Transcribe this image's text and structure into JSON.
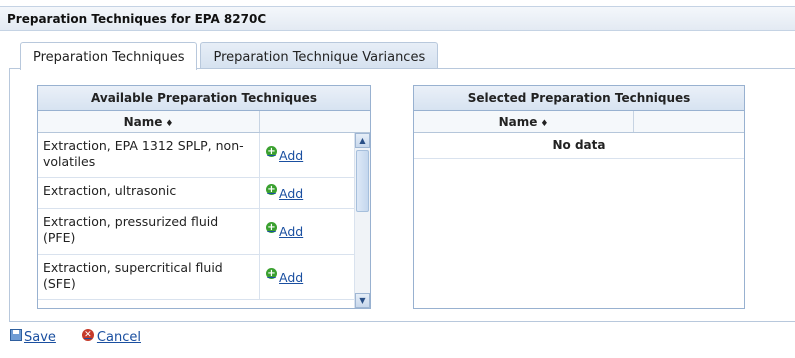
{
  "window": {
    "title": "Preparation Techniques for EPA 8270C"
  },
  "tabs": [
    {
      "label": "Preparation Techniques"
    },
    {
      "label": "Preparation Technique Variances"
    }
  ],
  "available": {
    "title": "Available Preparation Techniques",
    "col_name": "Name",
    "sort_glyph": "♦",
    "add_label": "Add",
    "rows": [
      {
        "name": "Extraction, EPA 1312 SPLP, non-volatiles"
      },
      {
        "name": "Extraction, ultrasonic"
      },
      {
        "name": "Extraction, pressurized fluid (PFE)"
      },
      {
        "name": "Extraction, supercritical fluid (SFE)"
      }
    ]
  },
  "selected": {
    "title": "Selected Preparation Techniques",
    "col_name": "Name",
    "sort_glyph": "♦",
    "empty_text": "No data"
  },
  "footer": {
    "save_label": "Save",
    "cancel_label": "Cancel"
  },
  "icons": {
    "add": "plus-circle-icon",
    "save": "floppy-disk-icon",
    "cancel": "x-circle-icon",
    "scroll_up": "chevron-up-icon",
    "scroll_down": "chevron-down-icon"
  },
  "colors": {
    "link": "#1a4fa0",
    "add_green": "#3aa02f",
    "cancel_red": "#c63a2a",
    "header_blue": "#d7e3f1"
  }
}
